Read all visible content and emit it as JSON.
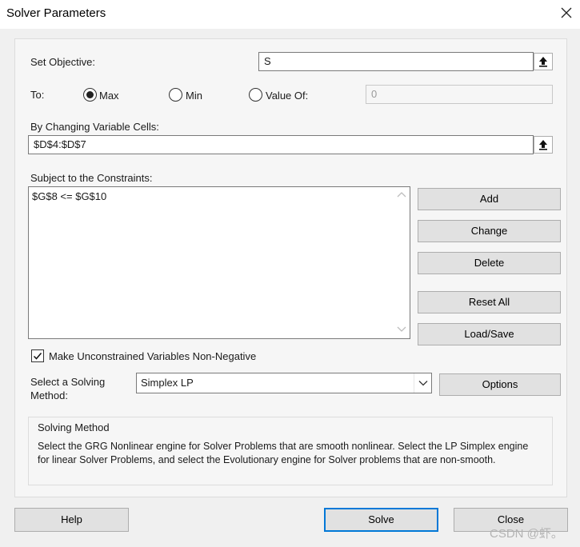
{
  "window": {
    "title": "Solver Parameters",
    "close_glyph": "✕"
  },
  "objective": {
    "label": "Set Objective:",
    "value": "S"
  },
  "to": {
    "label": "To:",
    "options": [
      {
        "label": "Max",
        "checked": true
      },
      {
        "label": "Min",
        "checked": false
      },
      {
        "label": "Value Of:",
        "checked": false
      }
    ],
    "value_of": "0"
  },
  "changing_cells": {
    "label": "By Changing Variable Cells:",
    "value": "$D$4:$D$7"
  },
  "constraints": {
    "label": "Subject to the Constraints:",
    "items": [
      "$G$8 <= $G$10"
    ]
  },
  "constraint_buttons": {
    "add": "Add",
    "change": "Change",
    "delete": "Delete",
    "reset_all": "Reset All",
    "load_save": "Load/Save"
  },
  "nonneg": {
    "label": "Make Unconstrained Variables Non-Negative",
    "checked": true
  },
  "method": {
    "label_line1": "Select a Solving",
    "label_line2": "Method:",
    "selected": "Simplex LP",
    "options_button": "Options"
  },
  "solving_method": {
    "title": "Solving Method",
    "description": "Select the GRG Nonlinear engine for Solver Problems that are smooth nonlinear. Select the LP Simplex engine for linear Solver Problems, and select the Evolutionary engine for Solver problems that are non-smooth."
  },
  "footer": {
    "help": "Help",
    "solve": "Solve",
    "close": "Close"
  },
  "watermark": "CSDN @虾。",
  "colors": {
    "default_button_border": "#0078d7",
    "button_face": "#e1e1e1",
    "dialog_bg": "#f0f0f0"
  },
  "icons": [
    "range-select-icon",
    "close-icon",
    "check-icon",
    "chevron-down-icon",
    "scroll-up-icon",
    "scroll-down-icon"
  ]
}
